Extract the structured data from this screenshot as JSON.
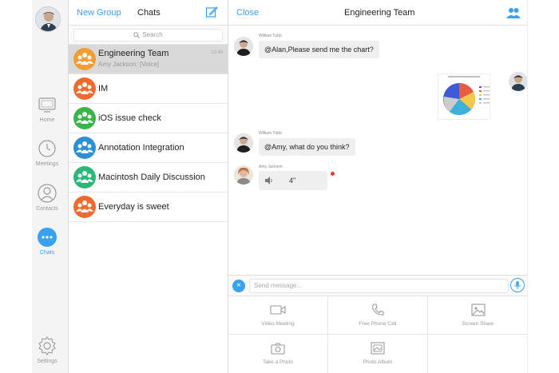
{
  "nav": {
    "items": [
      {
        "label": "Home",
        "icon": "home-icon"
      },
      {
        "label": "Meetings",
        "icon": "clock-icon"
      },
      {
        "label": "Contacts",
        "icon": "contacts-icon"
      },
      {
        "label": "Chats",
        "icon": "chat-icon",
        "active": true
      },
      {
        "label": "Settings",
        "icon": "gear-icon"
      }
    ]
  },
  "list": {
    "new_group": "New Group",
    "title": "Chats",
    "search_placeholder": "Search",
    "chats": [
      {
        "name": "Engineering Team",
        "preview": "Amy Jackson: [Voice]",
        "time": "10:48",
        "color": "#f39c34",
        "selected": true
      },
      {
        "name": "IM",
        "color": "#ef6a2c"
      },
      {
        "name": "iOS issue check",
        "color": "#3bb44a"
      },
      {
        "name": "Annotation Integration",
        "color": "#2d8fd6"
      },
      {
        "name": "Macintosh Daily Discussion",
        "color": "#2bb67a"
      },
      {
        "name": "Everyday is sweet",
        "color": "#ef6a2c"
      }
    ]
  },
  "chat": {
    "close": "Close",
    "title": "Engineering Team",
    "messages": [
      {
        "sender": "William Tubb",
        "text": "@Alan,Please send me the chart?"
      },
      {
        "sender": "William Tubb",
        "text": "@Amy, what do you think?"
      },
      {
        "sender": "Amy Jackson",
        "voice_duration": "4\""
      }
    ],
    "input_placeholder": "Send message...",
    "actions": [
      {
        "label": "Video Meeting",
        "icon": "video-icon"
      },
      {
        "label": "Free Phone Call",
        "icon": "phone-icon"
      },
      {
        "label": "Screen Share",
        "icon": "image-icon"
      },
      {
        "label": "Take a Photo",
        "icon": "camera-icon"
      },
      {
        "label": "Photo Album",
        "icon": "album-icon"
      }
    ]
  },
  "colors": {
    "accent": "#3aa0f0",
    "unread": "#e53935"
  }
}
